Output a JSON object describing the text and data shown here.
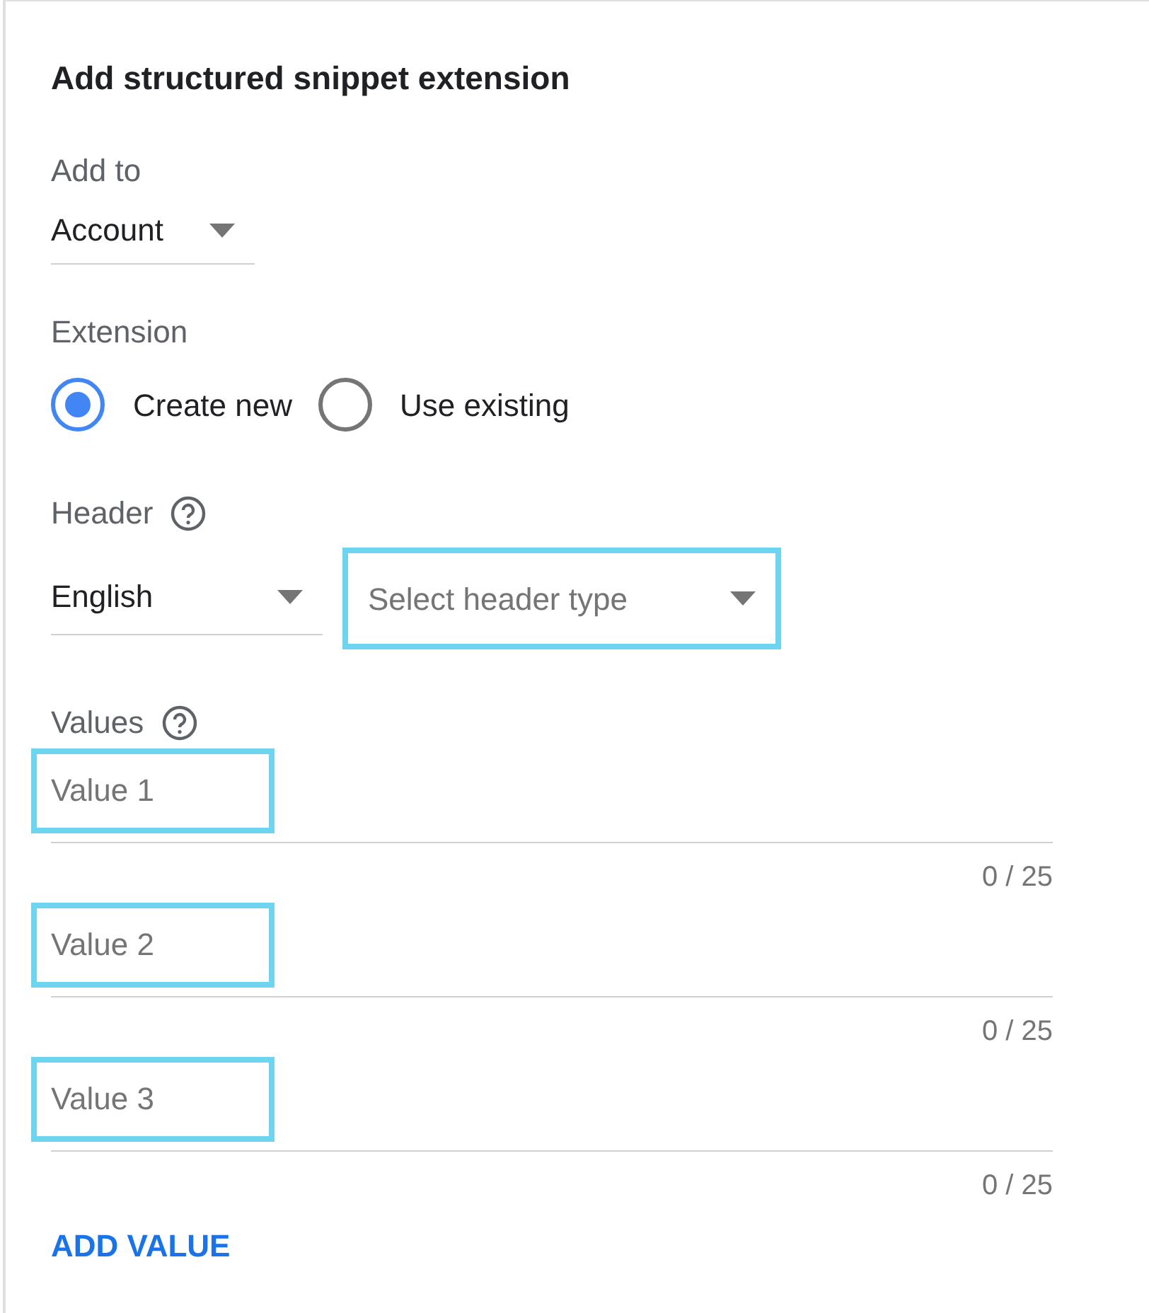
{
  "title": "Add structured snippet extension",
  "add_to": {
    "label": "Add to",
    "value": "Account"
  },
  "extension": {
    "label": "Extension",
    "options": [
      {
        "label": "Create new",
        "selected": true
      },
      {
        "label": "Use existing",
        "selected": false
      }
    ]
  },
  "header": {
    "label": "Header",
    "language": "English",
    "type": {
      "placeholder": "Select header type",
      "highlighted": true
    }
  },
  "values": {
    "label": "Values",
    "fields": [
      {
        "placeholder": "Value 1",
        "counter": "0 / 25",
        "highlighted": true
      },
      {
        "placeholder": "Value 2",
        "counter": "0 / 25",
        "highlighted": true
      },
      {
        "placeholder": "Value 3",
        "counter": "0 / 25",
        "highlighted": true
      }
    ]
  },
  "add_button": "ADD VALUE"
}
